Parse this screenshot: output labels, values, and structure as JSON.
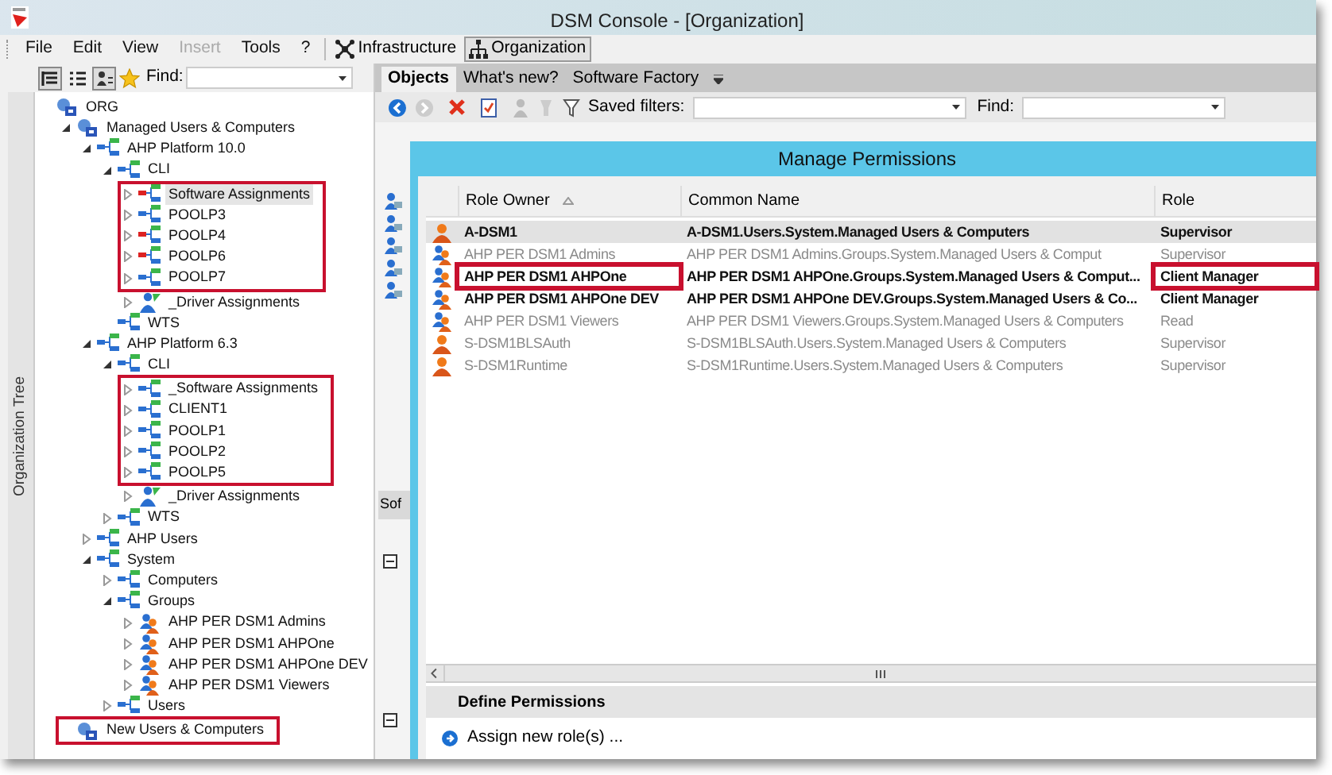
{
  "window": {
    "title": "DSM Console - [Organization]"
  },
  "menu": [
    {
      "label": "File",
      "disabled": false
    },
    {
      "label": "Edit",
      "disabled": false
    },
    {
      "label": "View",
      "disabled": false
    },
    {
      "label": "Insert",
      "disabled": true
    },
    {
      "label": "Tools",
      "disabled": false
    },
    {
      "label": "?",
      "disabled": false
    }
  ],
  "views": [
    {
      "label": "Infrastructure",
      "kind": "network",
      "selected": false
    },
    {
      "label": "Organization",
      "kind": "hierarchy",
      "selected": true
    }
  ],
  "left_panel": {
    "find_label": "Find:",
    "side_tab": "Organization Tree",
    "tree": [
      {
        "label": "ORG",
        "kind": "org",
        "boxed": false,
        "children": [
          {
            "label": "Managed Users & Computers",
            "kind": "org",
            "expanded": true,
            "boxed": false,
            "children": [
              {
                "label": "AHP Platform 10.0",
                "kind": "unit",
                "expanded": true,
                "boxed": false,
                "children": [
                  {
                    "label": "CLI",
                    "kind": "unit",
                    "expanded": true,
                    "boxed": false,
                    "children": [
                      {
                        "label": "Software Assignments",
                        "kind": "software",
                        "expanded": false,
                        "boxed": true,
                        "selected": true
                      },
                      {
                        "label": "POOLP3",
                        "kind": "unit",
                        "expanded": false,
                        "boxed": true,
                        "selected": false
                      },
                      {
                        "label": "POOLP4",
                        "kind": "software",
                        "expanded": false,
                        "boxed": true,
                        "selected": false
                      },
                      {
                        "label": "POOLP6",
                        "kind": "software",
                        "expanded": false,
                        "boxed": true,
                        "selected": false
                      },
                      {
                        "label": "POOLP7",
                        "kind": "unit",
                        "expanded": false,
                        "boxed": true,
                        "selected": false
                      },
                      {
                        "label": "_Driver Assignments",
                        "kind": "driver",
                        "expanded": false,
                        "boxed": false,
                        "selected": false
                      }
                    ]
                  },
                  {
                    "label": "WTS",
                    "kind": "unit",
                    "boxed": false
                  }
                ]
              },
              {
                "label": "AHP Platform 6.3",
                "kind": "unit",
                "expanded": true,
                "boxed": false,
                "children": [
                  {
                    "label": "CLI",
                    "kind": "unit",
                    "expanded": true,
                    "boxed": false,
                    "children": [
                      {
                        "label": "_Software Assignments",
                        "kind": "unit",
                        "expanded": false,
                        "boxed": true
                      },
                      {
                        "label": "CLIENT1",
                        "kind": "unit",
                        "expanded": false,
                        "boxed": true
                      },
                      {
                        "label": "POOLP1",
                        "kind": "unit",
                        "expanded": false,
                        "boxed": true
                      },
                      {
                        "label": "POOLP2",
                        "kind": "unit",
                        "expanded": false,
                        "boxed": true
                      },
                      {
                        "label": "POOLP5",
                        "kind": "unit",
                        "expanded": false,
                        "boxed": true
                      },
                      {
                        "label": "_Driver Assignments",
                        "kind": "driver",
                        "expanded": false,
                        "boxed": false
                      }
                    ]
                  },
                  {
                    "label": "WTS",
                    "kind": "unit",
                    "expanded": false,
                    "boxed": false
                  }
                ]
              },
              {
                "label": "AHP Users",
                "kind": "unit",
                "expanded": false,
                "boxed": false
              },
              {
                "label": "System",
                "kind": "unit",
                "expanded": true,
                "boxed": false,
                "children": [
                  {
                    "label": "Computers",
                    "kind": "unit",
                    "expanded": false,
                    "boxed": false
                  },
                  {
                    "label": "Groups",
                    "kind": "unit",
                    "expanded": true,
                    "boxed": false,
                    "children": [
                      {
                        "label": "AHP PER DSM1 Admins",
                        "kind": "group",
                        "expanded": false,
                        "boxed": false
                      },
                      {
                        "label": "AHP PER DSM1 AHPOne",
                        "kind": "group",
                        "expanded": false,
                        "boxed": false
                      },
                      {
                        "label": "AHP PER DSM1 AHPOne DEV",
                        "kind": "group",
                        "expanded": false,
                        "boxed": false
                      },
                      {
                        "label": "AHP PER DSM1 Viewers",
                        "kind": "group",
                        "expanded": false,
                        "boxed": false
                      }
                    ]
                  },
                  {
                    "label": "Users",
                    "kind": "unit",
                    "expanded": false,
                    "boxed": false
                  }
                ]
              }
            ]
          },
          {
            "label": "New Users & Computers",
            "kind": "org",
            "boxed": true
          }
        ]
      }
    ]
  },
  "right_panel": {
    "tabs": [
      {
        "label": "Objects",
        "selected": true
      },
      {
        "label": "What's new?",
        "selected": false
      },
      {
        "label": "Software Factory",
        "selected": false
      }
    ],
    "saved_filters_label": "Saved filters:",
    "find_label": "Find:",
    "background_tab": "Sof"
  },
  "dialog": {
    "title": "Manage Permissions",
    "columns": [
      {
        "label": "Role Owner",
        "sorted": true
      },
      {
        "label": "Common Name",
        "sorted": false
      },
      {
        "label": "Role",
        "sorted": false
      }
    ],
    "rows": [
      {
        "kind": "user",
        "owner": "A-DSM1",
        "common_name": "A-DSM1.Users.System.Managed Users & Computers",
        "role": "Supervisor",
        "selected": true,
        "dimmed": false,
        "boxed": false
      },
      {
        "kind": "group",
        "owner": "AHP PER DSM1 Admins",
        "common_name": "AHP PER DSM1 Admins.Groups.System.Managed Users & Comput",
        "role": "Supervisor",
        "selected": false,
        "dimmed": true,
        "boxed": false
      },
      {
        "kind": "group",
        "owner": "AHP PER DSM1 AHPOne",
        "common_name": "AHP PER DSM1 AHPOne.Groups.System.Managed Users & Comput...",
        "role": "Client Manager",
        "selected": false,
        "dimmed": false,
        "boxed": true
      },
      {
        "kind": "group",
        "owner": "AHP PER DSM1 AHPOne DEV",
        "common_name": "AHP PER DSM1 AHPOne DEV.Groups.System.Managed Users & Co...",
        "role": "Client Manager",
        "selected": false,
        "dimmed": false,
        "boxed": false
      },
      {
        "kind": "group",
        "owner": "AHP PER DSM1 Viewers",
        "common_name": "AHP PER DSM1 Viewers.Groups.System.Managed Users & Computers",
        "role": "Read",
        "selected": false,
        "dimmed": true,
        "boxed": false
      },
      {
        "kind": "user",
        "owner": "S-DSM1BLSAuth",
        "common_name": "S-DSM1BLSAuth.Users.System.Managed Users & Computers",
        "role": "Supervisor",
        "selected": false,
        "dimmed": true,
        "boxed": false
      },
      {
        "kind": "user",
        "owner": "S-DSM1Runtime",
        "common_name": "S-DSM1Runtime.Users.System.Managed Users & Computers",
        "role": "Supervisor",
        "selected": false,
        "dimmed": true,
        "boxed": false
      }
    ],
    "section_title": "Define Permissions",
    "action": "Assign new role(s) ..."
  }
}
